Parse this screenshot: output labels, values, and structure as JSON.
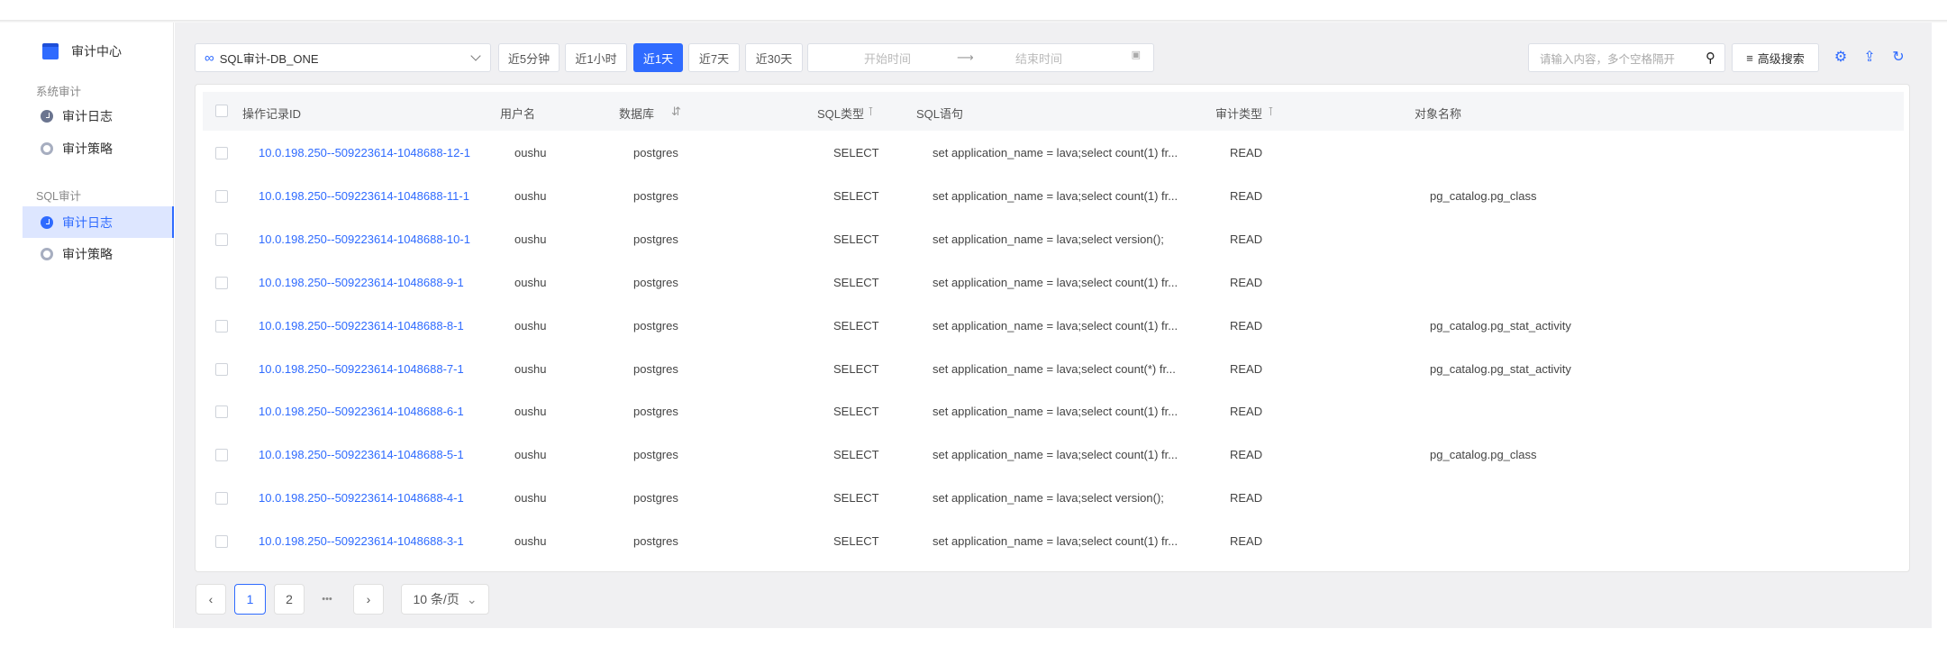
{
  "sidebar": {
    "title": "审计中心",
    "group1": "系统审计",
    "group2": "SQL审计",
    "items": [
      {
        "label": "审计日志"
      },
      {
        "label": "审计策略"
      },
      {
        "label": "审计日志"
      },
      {
        "label": "审计策略"
      }
    ]
  },
  "toolbar": {
    "select": "SQL审计-DB_ONE",
    "ranges": [
      "近5分钟",
      "近1小时",
      "近1天",
      "近7天",
      "近30天"
    ],
    "start_placeholder": "开始时间",
    "end_placeholder": "结束时间",
    "search_placeholder": "请输入内容，多个空格隔开",
    "advanced": "高级搜索"
  },
  "table": {
    "headers": {
      "id": "操作记录ID",
      "user": "用户名",
      "db": "数据库",
      "sqltype": "SQL类型",
      "stmt": "SQL语句",
      "audittype": "审计类型",
      "obj": "对象名称"
    },
    "rows": [
      {
        "id": "10.0.198.250--509223614-1048688-12-1",
        "user": "oushu",
        "db": "postgres",
        "sqltype": "SELECT",
        "stmt": "set application_name = lava;select count(1) fr...",
        "audittype": "READ",
        "obj": ""
      },
      {
        "id": "10.0.198.250--509223614-1048688-11-1",
        "user": "oushu",
        "db": "postgres",
        "sqltype": "SELECT",
        "stmt": "set application_name = lava;select count(1) fr...",
        "audittype": "READ",
        "obj": "pg_catalog.pg_class"
      },
      {
        "id": "10.0.198.250--509223614-1048688-10-1",
        "user": "oushu",
        "db": "postgres",
        "sqltype": "SELECT",
        "stmt": "set application_name = lava;select version();",
        "audittype": "READ",
        "obj": ""
      },
      {
        "id": "10.0.198.250--509223614-1048688-9-1",
        "user": "oushu",
        "db": "postgres",
        "sqltype": "SELECT",
        "stmt": "set application_name = lava;select count(1) fr...",
        "audittype": "READ",
        "obj": ""
      },
      {
        "id": "10.0.198.250--509223614-1048688-8-1",
        "user": "oushu",
        "db": "postgres",
        "sqltype": "SELECT",
        "stmt": "set application_name = lava;select count(1) fr...",
        "audittype": "READ",
        "obj": "pg_catalog.pg_stat_activity"
      },
      {
        "id": "10.0.198.250--509223614-1048688-7-1",
        "user": "oushu",
        "db": "postgres",
        "sqltype": "SELECT",
        "stmt": "set application_name = lava;select count(*) fr...",
        "audittype": "READ",
        "obj": "pg_catalog.pg_stat_activity"
      },
      {
        "id": "10.0.198.250--509223614-1048688-6-1",
        "user": "oushu",
        "db": "postgres",
        "sqltype": "SELECT",
        "stmt": "set application_name = lava;select count(1) fr...",
        "audittype": "READ",
        "obj": ""
      },
      {
        "id": "10.0.198.250--509223614-1048688-5-1",
        "user": "oushu",
        "db": "postgres",
        "sqltype": "SELECT",
        "stmt": "set application_name = lava;select count(1) fr...",
        "audittype": "READ",
        "obj": "pg_catalog.pg_class"
      },
      {
        "id": "10.0.198.250--509223614-1048688-4-1",
        "user": "oushu",
        "db": "postgres",
        "sqltype": "SELECT",
        "stmt": "set application_name = lava;select version();",
        "audittype": "READ",
        "obj": ""
      },
      {
        "id": "10.0.198.250--509223614-1048688-3-1",
        "user": "oushu",
        "db": "postgres",
        "sqltype": "SELECT",
        "stmt": "set application_name = lava;select count(1) fr...",
        "audittype": "READ",
        "obj": ""
      }
    ]
  },
  "pagination": {
    "pages": [
      "1",
      "2"
    ],
    "ellipsis": "•••",
    "page_size": "10 条/页",
    "current": 1
  }
}
